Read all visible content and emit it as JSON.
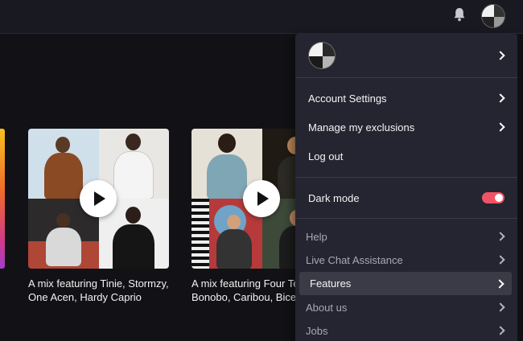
{
  "topbar": {
    "bell_icon": "bell-icon",
    "avatar_icon": "user-avatar"
  },
  "cards": [
    {
      "caption_line1": "A mix featuring Tinie, Stormzy,",
      "caption_line2": "One Acen, Hardy Caprio"
    },
    {
      "caption_line1": "A mix featuring Four Te",
      "caption_line2": "Bonobo, Caribou, Bicep"
    }
  ],
  "menu": {
    "account_settings": "Account Settings",
    "manage_exclusions": "Manage my exclusions",
    "log_out": "Log out",
    "dark_mode": "Dark mode",
    "dark_mode_on": true,
    "help": "Help",
    "live_chat": "Live Chat Assistance",
    "features": "Features",
    "about_us": "About us",
    "jobs": "Jobs"
  },
  "colors": {
    "accent": "#ef5466",
    "menu_bg": "#252531",
    "page_bg": "#121216"
  }
}
